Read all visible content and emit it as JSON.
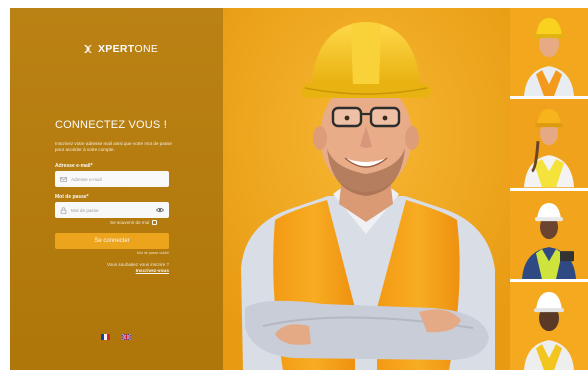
{
  "brand": {
    "logo_text_bold": "XPERT",
    "logo_text_light": "ONE"
  },
  "login": {
    "heading": "CONNECTEZ VOUS !",
    "description": "Inscrivez votre adresse mail ainsi que votre mot de passe pour accéder à votre compte.",
    "email_label": "Adresse e-mail*",
    "email_placeholder": "Adresse e-mail",
    "password_label": "Mot de passe*",
    "password_placeholder": "Mot de passe",
    "remember_label": "Se souvenir de moi",
    "submit_label": "Se connecter",
    "forgot_label": "Mot de passe oublié",
    "signup_question": "Vous souhaitez vous inscrire ?",
    "signup_link": "Inscrivez-vous"
  },
  "languages": [
    "fr-flag-icon",
    "uk-flag-icon"
  ],
  "colors": {
    "panel": "#b87c0a",
    "accent": "#f4a81a",
    "hero_bg": "#f2a81e",
    "vest": "#f5a623",
    "helmet": "#f6c614"
  }
}
